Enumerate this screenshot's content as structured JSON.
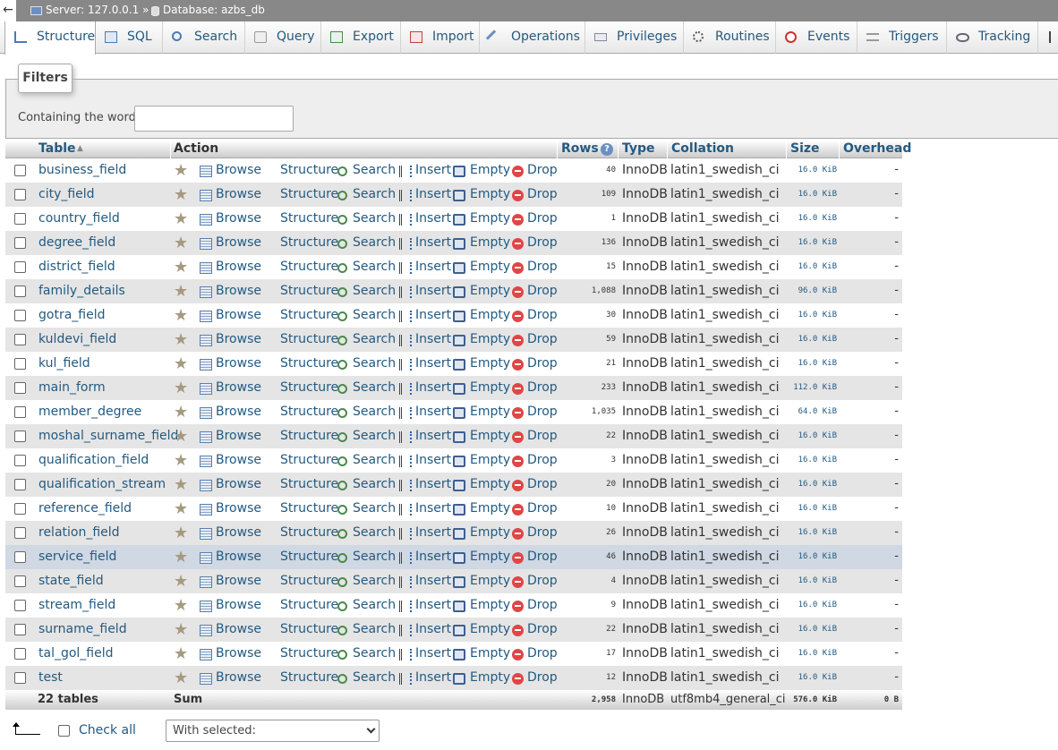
{
  "breadcrumb": {
    "server": "Server: 127.0.0.1 »",
    "database": "Database: azbs_db"
  },
  "tabs": [
    {
      "label": "Structure",
      "icon": "structure-icon",
      "active": true
    },
    {
      "label": "SQL",
      "icon": "sql-icon"
    },
    {
      "label": "Search",
      "icon": "search-icon"
    },
    {
      "label": "Query",
      "icon": "query-icon"
    },
    {
      "label": "Export",
      "icon": "export-icon"
    },
    {
      "label": "Import",
      "icon": "import-icon"
    },
    {
      "label": "Operations",
      "icon": "wrench-icon"
    },
    {
      "label": "Privileges",
      "icon": "privileges-icon"
    },
    {
      "label": "Routines",
      "icon": "routines-icon"
    },
    {
      "label": "Events",
      "icon": "clock-icon"
    },
    {
      "label": "Triggers",
      "icon": "triggers-icon"
    },
    {
      "label": "Tracking",
      "icon": "eye-icon"
    }
  ],
  "filters": {
    "legend": "Filters",
    "label": "Containing the word:",
    "value": ""
  },
  "columns": {
    "table": "Table",
    "action": "Action",
    "rows": "Rows",
    "type": "Type",
    "collation": "Collation",
    "size": "Size",
    "overhead": "Overhead"
  },
  "actions": {
    "browse": "Browse",
    "structure": "Structure",
    "search": "Search",
    "insert": "Insert",
    "empty": "Empty",
    "drop": "Drop"
  },
  "tables": [
    {
      "name": "business_field",
      "rows": "40",
      "type": "InnoDB",
      "collation": "latin1_swedish_ci",
      "size": "16.0",
      "unit": "KiB",
      "overhead": "-"
    },
    {
      "name": "city_field",
      "rows": "109",
      "type": "InnoDB",
      "collation": "latin1_swedish_ci",
      "size": "16.0",
      "unit": "KiB",
      "overhead": "-"
    },
    {
      "name": "country_field",
      "rows": "1",
      "type": "InnoDB",
      "collation": "latin1_swedish_ci",
      "size": "16.0",
      "unit": "KiB",
      "overhead": "-"
    },
    {
      "name": "degree_field",
      "rows": "136",
      "type": "InnoDB",
      "collation": "latin1_swedish_ci",
      "size": "16.0",
      "unit": "KiB",
      "overhead": "-"
    },
    {
      "name": "district_field",
      "rows": "15",
      "type": "InnoDB",
      "collation": "latin1_swedish_ci",
      "size": "16.0",
      "unit": "KiB",
      "overhead": "-"
    },
    {
      "name": "family_details",
      "rows": "1,088",
      "type": "InnoDB",
      "collation": "latin1_swedish_ci",
      "size": "96.0",
      "unit": "KiB",
      "overhead": "-"
    },
    {
      "name": "gotra_field",
      "rows": "30",
      "type": "InnoDB",
      "collation": "latin1_swedish_ci",
      "size": "16.0",
      "unit": "KiB",
      "overhead": "-"
    },
    {
      "name": "kuldevi_field",
      "rows": "59",
      "type": "InnoDB",
      "collation": "latin1_swedish_ci",
      "size": "16.0",
      "unit": "KiB",
      "overhead": "-"
    },
    {
      "name": "kul_field",
      "rows": "21",
      "type": "InnoDB",
      "collation": "latin1_swedish_ci",
      "size": "16.0",
      "unit": "KiB",
      "overhead": "-"
    },
    {
      "name": "main_form",
      "rows": "233",
      "type": "InnoDB",
      "collation": "latin1_swedish_ci",
      "size": "112.0",
      "unit": "KiB",
      "overhead": "-"
    },
    {
      "name": "member_degree",
      "rows": "1,035",
      "type": "InnoDB",
      "collation": "latin1_swedish_ci",
      "size": "64.0",
      "unit": "KiB",
      "overhead": "-"
    },
    {
      "name": "moshal_surname_field",
      "rows": "22",
      "type": "InnoDB",
      "collation": "latin1_swedish_ci",
      "size": "16.0",
      "unit": "KiB",
      "overhead": "-"
    },
    {
      "name": "qualification_field",
      "rows": "3",
      "type": "InnoDB",
      "collation": "latin1_swedish_ci",
      "size": "16.0",
      "unit": "KiB",
      "overhead": "-"
    },
    {
      "name": "qualification_stream",
      "rows": "20",
      "type": "InnoDB",
      "collation": "latin1_swedish_ci",
      "size": "16.0",
      "unit": "KiB",
      "overhead": "-"
    },
    {
      "name": "reference_field",
      "rows": "10",
      "type": "InnoDB",
      "collation": "latin1_swedish_ci",
      "size": "16.0",
      "unit": "KiB",
      "overhead": "-"
    },
    {
      "name": "relation_field",
      "rows": "26",
      "type": "InnoDB",
      "collation": "latin1_swedish_ci",
      "size": "16.0",
      "unit": "KiB",
      "overhead": "-"
    },
    {
      "name": "service_field",
      "rows": "46",
      "type": "InnoDB",
      "collation": "latin1_swedish_ci",
      "size": "16.0",
      "unit": "KiB",
      "overhead": "-",
      "highlighted": true
    },
    {
      "name": "state_field",
      "rows": "4",
      "type": "InnoDB",
      "collation": "latin1_swedish_ci",
      "size": "16.0",
      "unit": "KiB",
      "overhead": "-"
    },
    {
      "name": "stream_field",
      "rows": "9",
      "type": "InnoDB",
      "collation": "latin1_swedish_ci",
      "size": "16.0",
      "unit": "KiB",
      "overhead": "-"
    },
    {
      "name": "surname_field",
      "rows": "22",
      "type": "InnoDB",
      "collation": "latin1_swedish_ci",
      "size": "16.0",
      "unit": "KiB",
      "overhead": "-"
    },
    {
      "name": "tal_gol_field",
      "rows": "17",
      "type": "InnoDB",
      "collation": "latin1_swedish_ci",
      "size": "16.0",
      "unit": "KiB",
      "overhead": "-"
    },
    {
      "name": "test",
      "rows": "12",
      "type": "InnoDB",
      "collation": "latin1_swedish_ci",
      "size": "16.0",
      "unit": "KiB",
      "overhead": "-"
    }
  ],
  "summary": {
    "count": "22 tables",
    "label": "Sum",
    "rows": "2,958",
    "type": "InnoDB",
    "collation": "utf8mb4_general_ci",
    "size": "576.0 KiB",
    "overhead": "0 B"
  },
  "footer": {
    "check_all": "Check all",
    "with_selected": "With selected:"
  },
  "colors": {
    "link": "#235a81",
    "even_row": "#e5e5e5",
    "highlight_row": "#cfd8e3",
    "drop": "#e14545"
  }
}
